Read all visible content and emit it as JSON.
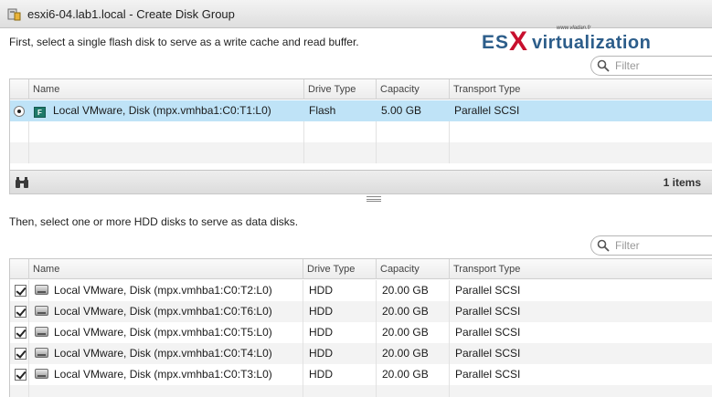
{
  "window": {
    "title": "esxi6-04.lab1.local - Create Disk Group"
  },
  "logo": {
    "site": "www.vladan.fr",
    "es": "ES",
    "x": "X",
    "rest": "virtualization"
  },
  "flash_section": {
    "instruction": "First, select a single flash disk to serve as a write cache and read buffer.",
    "filter_placeholder": "Filter",
    "columns": [
      "Name",
      "Drive Type",
      "Capacity",
      "Transport Type"
    ],
    "rows": [
      {
        "name": "Local VMware, Disk (mpx.vmhba1:C0:T1:L0)",
        "drive_type": "Flash",
        "capacity": "5.00 GB",
        "transport": "Parallel SCSI",
        "selected": true,
        "icon_letter": "F"
      }
    ],
    "item_count": "1 items"
  },
  "hdd_section": {
    "instruction": "Then, select one or more HDD disks to serve as data disks.",
    "filter_placeholder": "Filter",
    "columns": [
      "Name",
      "Drive Type",
      "Capacity",
      "Transport Type"
    ],
    "rows": [
      {
        "name": "Local VMware, Disk (mpx.vmhba1:C0:T2:L0)",
        "drive_type": "HDD",
        "capacity": "20.00 GB",
        "transport": "Parallel SCSI",
        "checked": true
      },
      {
        "name": "Local VMware, Disk (mpx.vmhba1:C0:T6:L0)",
        "drive_type": "HDD",
        "capacity": "20.00 GB",
        "transport": "Parallel SCSI",
        "checked": true
      },
      {
        "name": "Local VMware, Disk (mpx.vmhba1:C0:T5:L0)",
        "drive_type": "HDD",
        "capacity": "20.00 GB",
        "transport": "Parallel SCSI",
        "checked": true
      },
      {
        "name": "Local VMware, Disk (mpx.vmhba1:C0:T4:L0)",
        "drive_type": "HDD",
        "capacity": "20.00 GB",
        "transport": "Parallel SCSI",
        "checked": true
      },
      {
        "name": "Local VMware, Disk (mpx.vmhba1:C0:T3:L0)",
        "drive_type": "HDD",
        "capacity": "20.00 GB",
        "transport": "Parallel SCSI",
        "checked": true
      }
    ]
  },
  "colors": {
    "selected_row": "#bfe3f7",
    "brand_blue": "#2c5d8a",
    "brand_red": "#c8102e",
    "flash_icon": "#1f7a6a"
  },
  "icons": {
    "title": "disk-group-icon",
    "filter": "search-icon",
    "footer": "binoculars-icon",
    "flash_disk": "flash-disk-icon",
    "hdd": "hdd-icon"
  }
}
